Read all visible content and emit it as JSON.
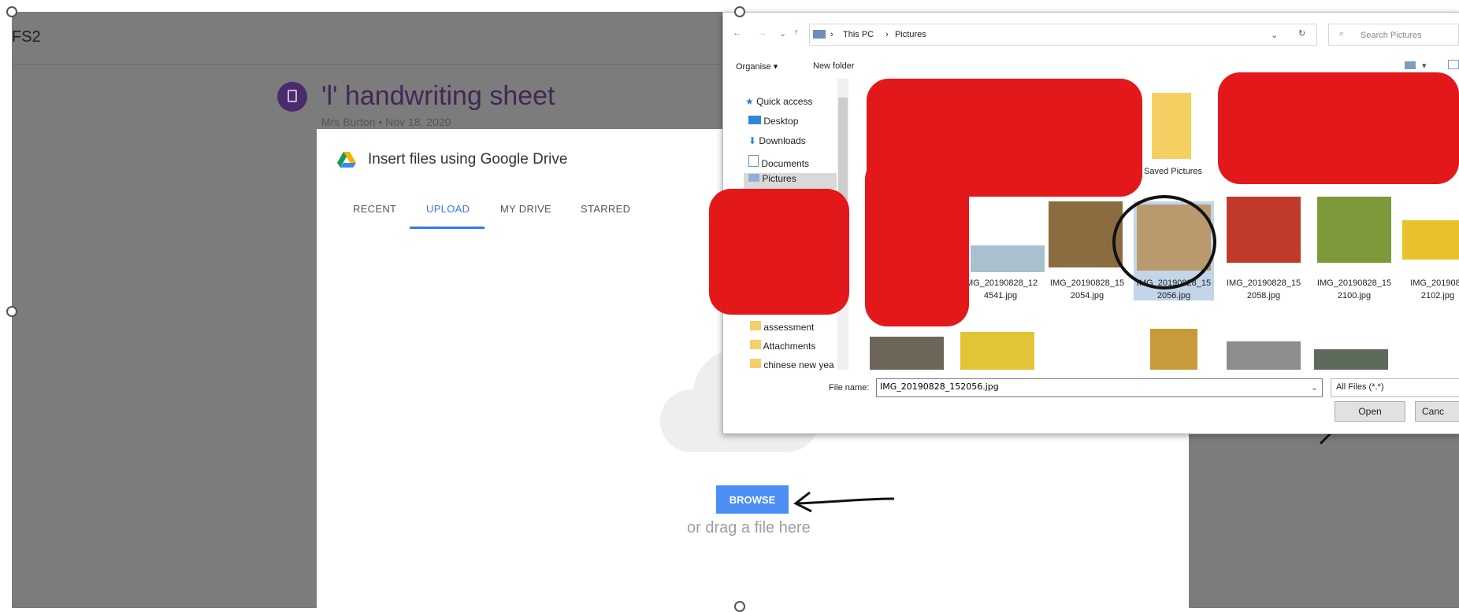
{
  "background_page": {
    "class_name": "FS2",
    "assignment_title": "'l' handwriting sheet",
    "assignment_meta": "Mrs Burton • Nov 18, 2020"
  },
  "drive_picker": {
    "title": "Insert files using Google Drive",
    "tabs": [
      "RECENT",
      "UPLOAD",
      "MY DRIVE",
      "STARRED"
    ],
    "active_tab": "UPLOAD",
    "browse_label": "BROWSE",
    "drag_text": "or drag a file here"
  },
  "file_dialog": {
    "breadcrumb": [
      "This PC",
      "Pictures"
    ],
    "search_placeholder": "Search Pictures",
    "toolbar": {
      "organise": "Organise",
      "new_folder": "New folder"
    },
    "nav_items": [
      "Quick access",
      "Desktop",
      "Downloads",
      "Documents",
      "Pictures"
    ],
    "nav_folders": [
      "assessment",
      "Attachments",
      "chinese new yea"
    ],
    "saved_folder": "Saved Pictures",
    "files": [
      {
        "name": "IMG_20190828_12\n4541.jpg"
      },
      {
        "name": "IMG_20190828_15\n2054.jpg"
      },
      {
        "name": "IMG_20190828_15\n2056.jpg"
      },
      {
        "name": "IMG_20190828_15\n2058.jpg"
      },
      {
        "name": "IMG_20190828_15\n2100.jpg"
      },
      {
        "name": "IMG_2019082\n2102.jpg"
      }
    ],
    "file_name_label": "File name:",
    "file_name_value": "IMG_20190828_152056.jpg",
    "file_type": "All Files (*.*)",
    "open_label": "Open",
    "cancel_label": "Canc"
  },
  "colors": {
    "redaction": "#e3181b",
    "drive_accent": "#3b78e7",
    "classroom_purple": "#4a2b6b"
  }
}
